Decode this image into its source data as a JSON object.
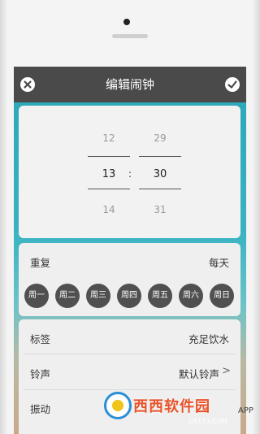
{
  "header": {
    "title": "编辑闹钟"
  },
  "time_picker": {
    "hour": {
      "prev": "12",
      "current": "13",
      "next": "14"
    },
    "minute": {
      "prev": "29",
      "current": "30",
      "next": "31"
    },
    "separator": ":"
  },
  "repeat": {
    "label": "重复",
    "value": "每天",
    "days": [
      "周一",
      "周二",
      "周三",
      "周四",
      "周五",
      "周六",
      "周日"
    ]
  },
  "settings": {
    "label_row": {
      "label": "标签",
      "value": "充足饮水"
    },
    "ringtone_row": {
      "label": "铃声",
      "value": "默认铃声",
      "chevron": ">"
    },
    "vibrate_row": {
      "label": "振动"
    }
  },
  "watermark": {
    "brand": "西西软件园",
    "url": "CR173.COM",
    "side_text": "APP"
  },
  "colors": {
    "topbar": "#4a4a4a",
    "day_button": "#505050",
    "background_teal": "#2aa6b8",
    "brand_orange": "#e8522a"
  }
}
